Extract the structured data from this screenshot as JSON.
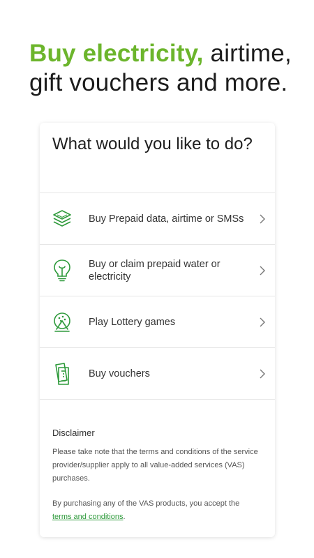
{
  "headline": {
    "accent": "Buy electricity,",
    "rest": " airtime, gift vouchers and more."
  },
  "card": {
    "title": "What would you like to do?",
    "options": [
      {
        "label": "Buy Prepaid data, airtime or SMSs",
        "icon": "layers-icon"
      },
      {
        "label": "Buy or claim prepaid water or electricity",
        "icon": "lightbulb-icon"
      },
      {
        "label": "Play Lottery games",
        "icon": "lottery-icon"
      },
      {
        "label": "Buy vouchers",
        "icon": "voucher-icon"
      }
    ]
  },
  "disclaimer": {
    "title": "Disclaimer",
    "paragraph1": "Please take note that the terms and conditions of the service provider/supplier apply to all value-added services (VAS) purchases.",
    "paragraph2": "By purchasing any of the VAS products, you accept the",
    "link": "terms and conditions",
    "link_suffix": "."
  },
  "colors": {
    "accent": "#6cb52c",
    "icon_green": "#2e9a3b",
    "link": "#2e9a3b"
  }
}
